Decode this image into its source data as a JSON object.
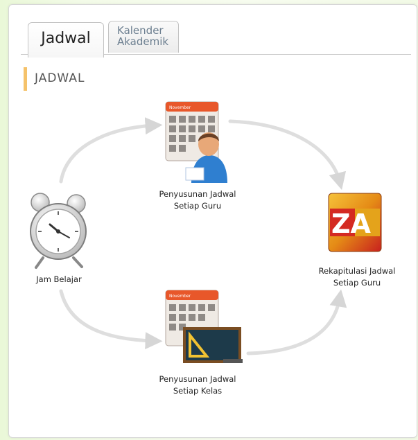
{
  "tabs": [
    {
      "label": "Jadwal",
      "active": true
    },
    {
      "label_line1": "Kalender",
      "label_line2": "Akademik",
      "active": false
    }
  ],
  "section": {
    "title": "JADWAL"
  },
  "nodes": {
    "jam_belajar": {
      "label": "Jam Belajar"
    },
    "guru": {
      "line1": "Penyusunan Jadwal",
      "line2": "Setiap Guru"
    },
    "kelas": {
      "line1": "Penyusunan Jadwal",
      "line2": "Setiap Kelas"
    },
    "rekap": {
      "line1": "Rekapitulasi Jadwal",
      "line2": "Setiap Guru",
      "icon_text": "ZA"
    }
  },
  "colors": {
    "accent": "#f5c26a",
    "arrow": "#d9d9d9",
    "calendar_header": "#e8572a",
    "za_red": "#c8201e",
    "za_gold": "#f0b01c"
  },
  "icons": {
    "alarm": "alarm-clock-icon",
    "teacher": "calendar-person-icon",
    "class": "calendar-blackboard-icon",
    "report": "za-sort-icon"
  }
}
